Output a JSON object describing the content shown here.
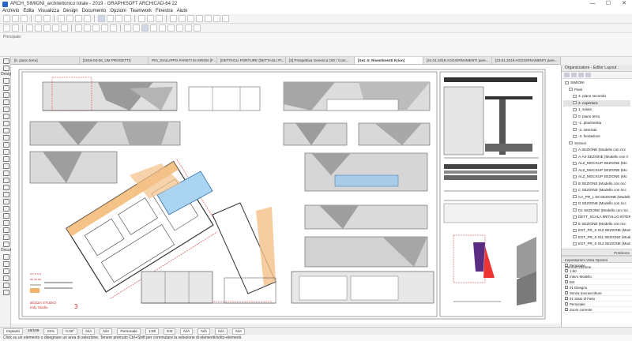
{
  "window": {
    "title": "ARCH_SIMIONI_architettonico totale - 2019 - GRAPHISOFT ARCHICAD-64 22",
    "minimize": "—",
    "maximize": "☐",
    "close": "✕"
  },
  "menu": [
    "Archivio",
    "Edita",
    "Visualizza",
    "Design",
    "Documento",
    "Opzioni",
    "Teamwork",
    "Finestra",
    "Aiuto"
  ],
  "infobar": {
    "label": "Principale:"
  },
  "tabs": [
    {
      "label": "[0. piano terra]",
      "active": false
    },
    {
      "label": "[2018-03-06_UM PROGETTI]",
      "active": false
    },
    {
      "label": "PIN_SVILUPPO PARETI IN KRION [F...",
      "active": false
    },
    {
      "label": "[DETTAGLI PORTURE (DETTAGLI PI...",
      "active": false
    },
    {
      "label": "[3] Prospettiva Generica (3D / Com...",
      "active": false
    },
    {
      "label": "[Sez. 5_Rivestimenti Krion]",
      "active": true
    },
    {
      "label": "[24.01.2018 AGGIORNAMENTI pare...",
      "active": false
    },
    {
      "label": "[23.01.2018 AGGIORNAMENTI pare...",
      "active": false
    }
  ],
  "toolbox": {
    "design_label": "Design",
    "docum_label": "Docume"
  },
  "organizer": {
    "title": "Organizzatore - Editor Layout",
    "tree": [
      {
        "label": "SIMIONI",
        "level": 0,
        "selected": false
      },
      {
        "label": "Piani",
        "level": 1,
        "selected": false
      },
      {
        "label": "3. piano secondo",
        "level": 2,
        "selected": false
      },
      {
        "label": "2. copertura",
        "level": 2,
        "selected": true
      },
      {
        "label": "1. solaio",
        "level": 2,
        "selected": false
      },
      {
        "label": "0. piano terra",
        "level": 2,
        "selected": false
      },
      {
        "label": "-1. planimetria",
        "level": 2,
        "selected": false
      },
      {
        "label": "-2. interrato",
        "level": 2,
        "selected": false
      },
      {
        "label": "-3. fondazioni",
        "level": 2,
        "selected": false
      },
      {
        "label": "Sezioni",
        "level": 1,
        "selected": false
      },
      {
        "label": "A SEZIONE (Modello con ricc",
        "level": 2,
        "selected": false
      },
      {
        "label": "A-A2 SEZIONE (Modello con ri",
        "level": 2,
        "selected": false
      },
      {
        "label": "ALZ_MOCKUP SEZIONE (Mo",
        "level": 2,
        "selected": false
      },
      {
        "label": "ALZ_MOCKUP SEZIONE (Mo",
        "level": 2,
        "selected": false
      },
      {
        "label": "ALZ_MOCKUP SEZIONE (Mo",
        "level": 2,
        "selected": false
      },
      {
        "label": "B SEZIONE (Modello con ricc",
        "level": 2,
        "selected": false
      },
      {
        "label": "C SEZIONE (Modello con ricc",
        "level": 2,
        "selected": false
      },
      {
        "label": "CA_PR_L 59 SEZIONE (Modello",
        "level": 2,
        "selected": false
      },
      {
        "label": "D SEZIONE (Modello con ricc",
        "level": 2,
        "selected": false
      },
      {
        "label": "D1 SEZIONE (Modello con ricc",
        "level": 2,
        "selected": false
      },
      {
        "label": "DETT_SCALA METALLO INTERR",
        "level": 2,
        "selected": false
      },
      {
        "label": "E SEZIONE (Modello con ricc",
        "level": 2,
        "selected": false
      },
      {
        "label": "EST_PR_S 010 SEZIONE (Mode",
        "level": 2,
        "selected": false
      },
      {
        "label": "EST_PR_S 011 SEZIONE (Mode",
        "level": 2,
        "selected": false
      },
      {
        "label": "EST_PR_S 012 SEZIONE (Mode",
        "level": 2,
        "selected": false
      }
    ],
    "position_label": "Posizione",
    "settings_label": "Impostazioni Vista Opzioni Memorizzazione",
    "layers": [
      "Personale",
      "1:50",
      "Intero Modello",
      "Est",
      "01 Disegno",
      "Senza Sovrascritture",
      "01 Stato di Fatto",
      "Personale",
      "Zoom corrente"
    ]
  },
  "status": {
    "impianti": "Impianti",
    "page": "18/109",
    "zoom": "24%",
    "angle": "0,00°",
    "na1": "N/A",
    "na2": "N/A",
    "personale": "Personale",
    "scale": "1:50",
    "est": "Est",
    "na3": "N/A",
    "na4": "N/A",
    "na5": "N/A",
    "na6": "N/A"
  },
  "hint": "Click su un elemento o disegnare un area di selezione. Tenere premuto Ctrl+Shift per commutare la selezione di elementi/sotto-elementi.",
  "drawing": {
    "stamp_line1": "BOZZA STUDIO",
    "stamp_line2": "Indy Studio",
    "stamp_num": "3"
  }
}
